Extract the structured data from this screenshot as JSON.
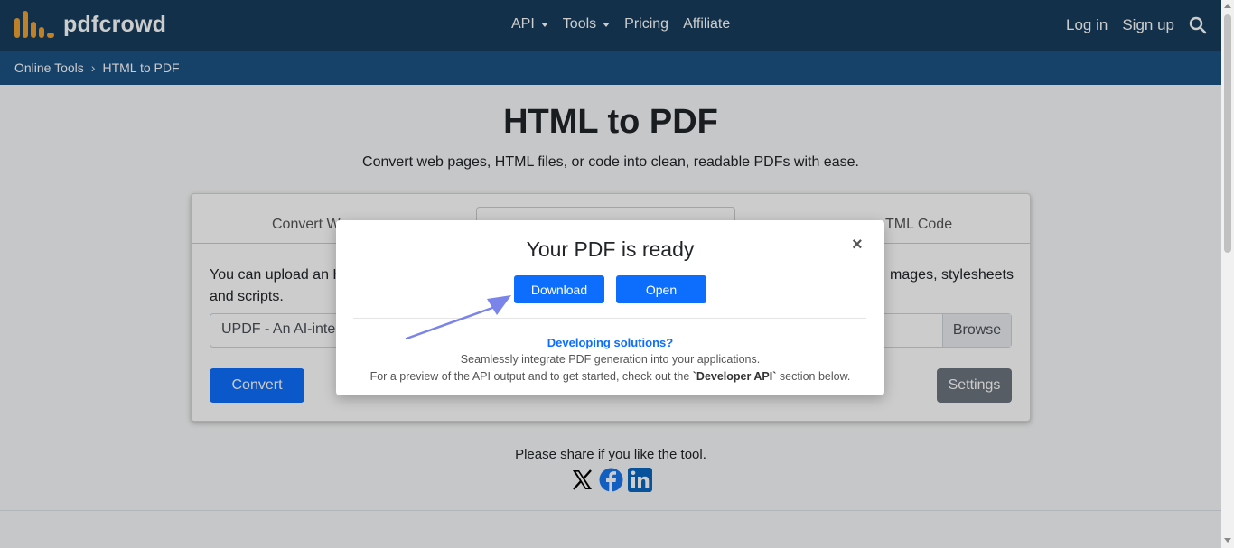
{
  "brand": {
    "name": "pdfcrowd"
  },
  "nav": {
    "api": "API",
    "tools": "Tools",
    "pricing": "Pricing",
    "affiliate": "Affiliate",
    "login": "Log in",
    "signup": "Sign up",
    "search_icon": "search-icon"
  },
  "breadcrumb": {
    "parent": "Online Tools",
    "separator": "›",
    "current": "HTML to PDF"
  },
  "hero": {
    "title": "HTML to PDF",
    "subtitle": "Convert web pages, HTML files, or code into clean, readable PDFs with ease."
  },
  "card": {
    "tab_left": "Convert W",
    "tab_right": "TML Code",
    "desc_left": "You can upload an H",
    "desc_right": "mages, stylesheets",
    "desc_line2": "and scripts.",
    "file_value": "UPDF - An AI-inte",
    "browse": "Browse",
    "convert": "Convert",
    "settings": "Settings"
  },
  "share": {
    "text": "Please share if you like the tool."
  },
  "modal": {
    "title": "Your PDF is ready",
    "close": "×",
    "download": "Download",
    "open": "Open",
    "heading": "Developing solutions?",
    "text1": "Seamlessly integrate PDF generation into your applications.",
    "text2_before": "For a preview of the API output and to get started, check out the ",
    "text2_bold": "`Developer API`",
    "text2_after": " section below."
  },
  "colors": {
    "nav_bg": "#173d5c",
    "crumb_bg": "#1c5283",
    "primary": "#0d6efd",
    "logo_orange": "#f0a030",
    "arrow": "#7b84e8"
  }
}
